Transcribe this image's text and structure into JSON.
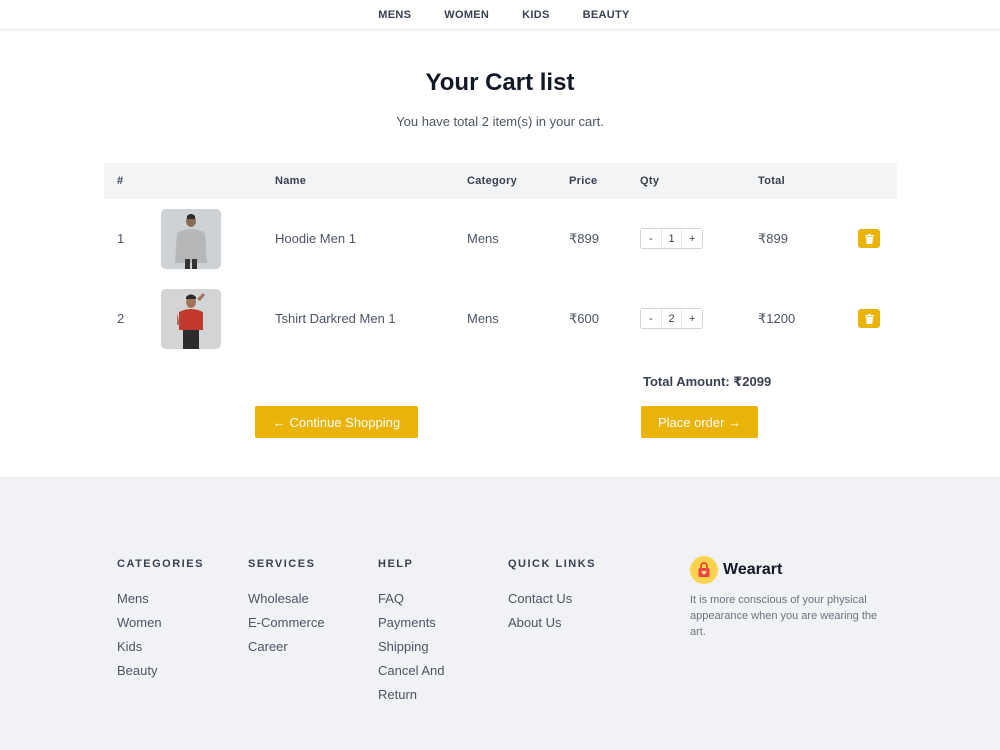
{
  "nav": {
    "items": [
      "MENS",
      "WOMEN",
      "KIDS",
      "BEAUTY"
    ]
  },
  "cart": {
    "title": "Your Cart list",
    "subtitle": "You have total 2 item(s) in your cart.",
    "columns": [
      "#",
      "Name",
      "Category",
      "Price",
      "Qty",
      "Total"
    ],
    "items": [
      {
        "index": "1",
        "name": "Hoodie Men 1",
        "category": "Mens",
        "price": "₹899",
        "qty": "1",
        "total": "₹899",
        "image": "hoodie-photo"
      },
      {
        "index": "2",
        "name": "Tshirt Darkred Men 1",
        "category": "Mens",
        "price": "₹600",
        "qty": "2",
        "total": "₹1200",
        "image": "tshirt-photo"
      }
    ],
    "qty_minus": "-",
    "qty_plus": "+",
    "total_amount": "Total Amount: ₹2099",
    "continue_label": "← Continue Shopping",
    "order_label": "Place order →",
    "delete_icon": "trash-icon"
  },
  "footer": {
    "columns": [
      {
        "heading": "CATEGORIES",
        "links": [
          "Mens",
          "Women",
          "Kids",
          "Beauty"
        ]
      },
      {
        "heading": "SERVICES",
        "links": [
          "Wholesale",
          "E-Commerce",
          "Career"
        ]
      },
      {
        "heading": "HELP",
        "links": [
          "FAQ",
          "Payments",
          "Shipping",
          "Cancel And",
          "Return"
        ]
      },
      {
        "heading": "QUICK LINKS",
        "links": [
          "Contact Us",
          "About Us"
        ]
      }
    ],
    "brand": {
      "name": "Wearart",
      "description": "It is more conscious of your physical appearance when you are wearing the art.",
      "logo_icon": "shopping-bag-icon"
    }
  },
  "colors": {
    "accent": "#eab308",
    "footer_bg": "#f0f2f6",
    "header_bg": "#f3f4f6"
  }
}
